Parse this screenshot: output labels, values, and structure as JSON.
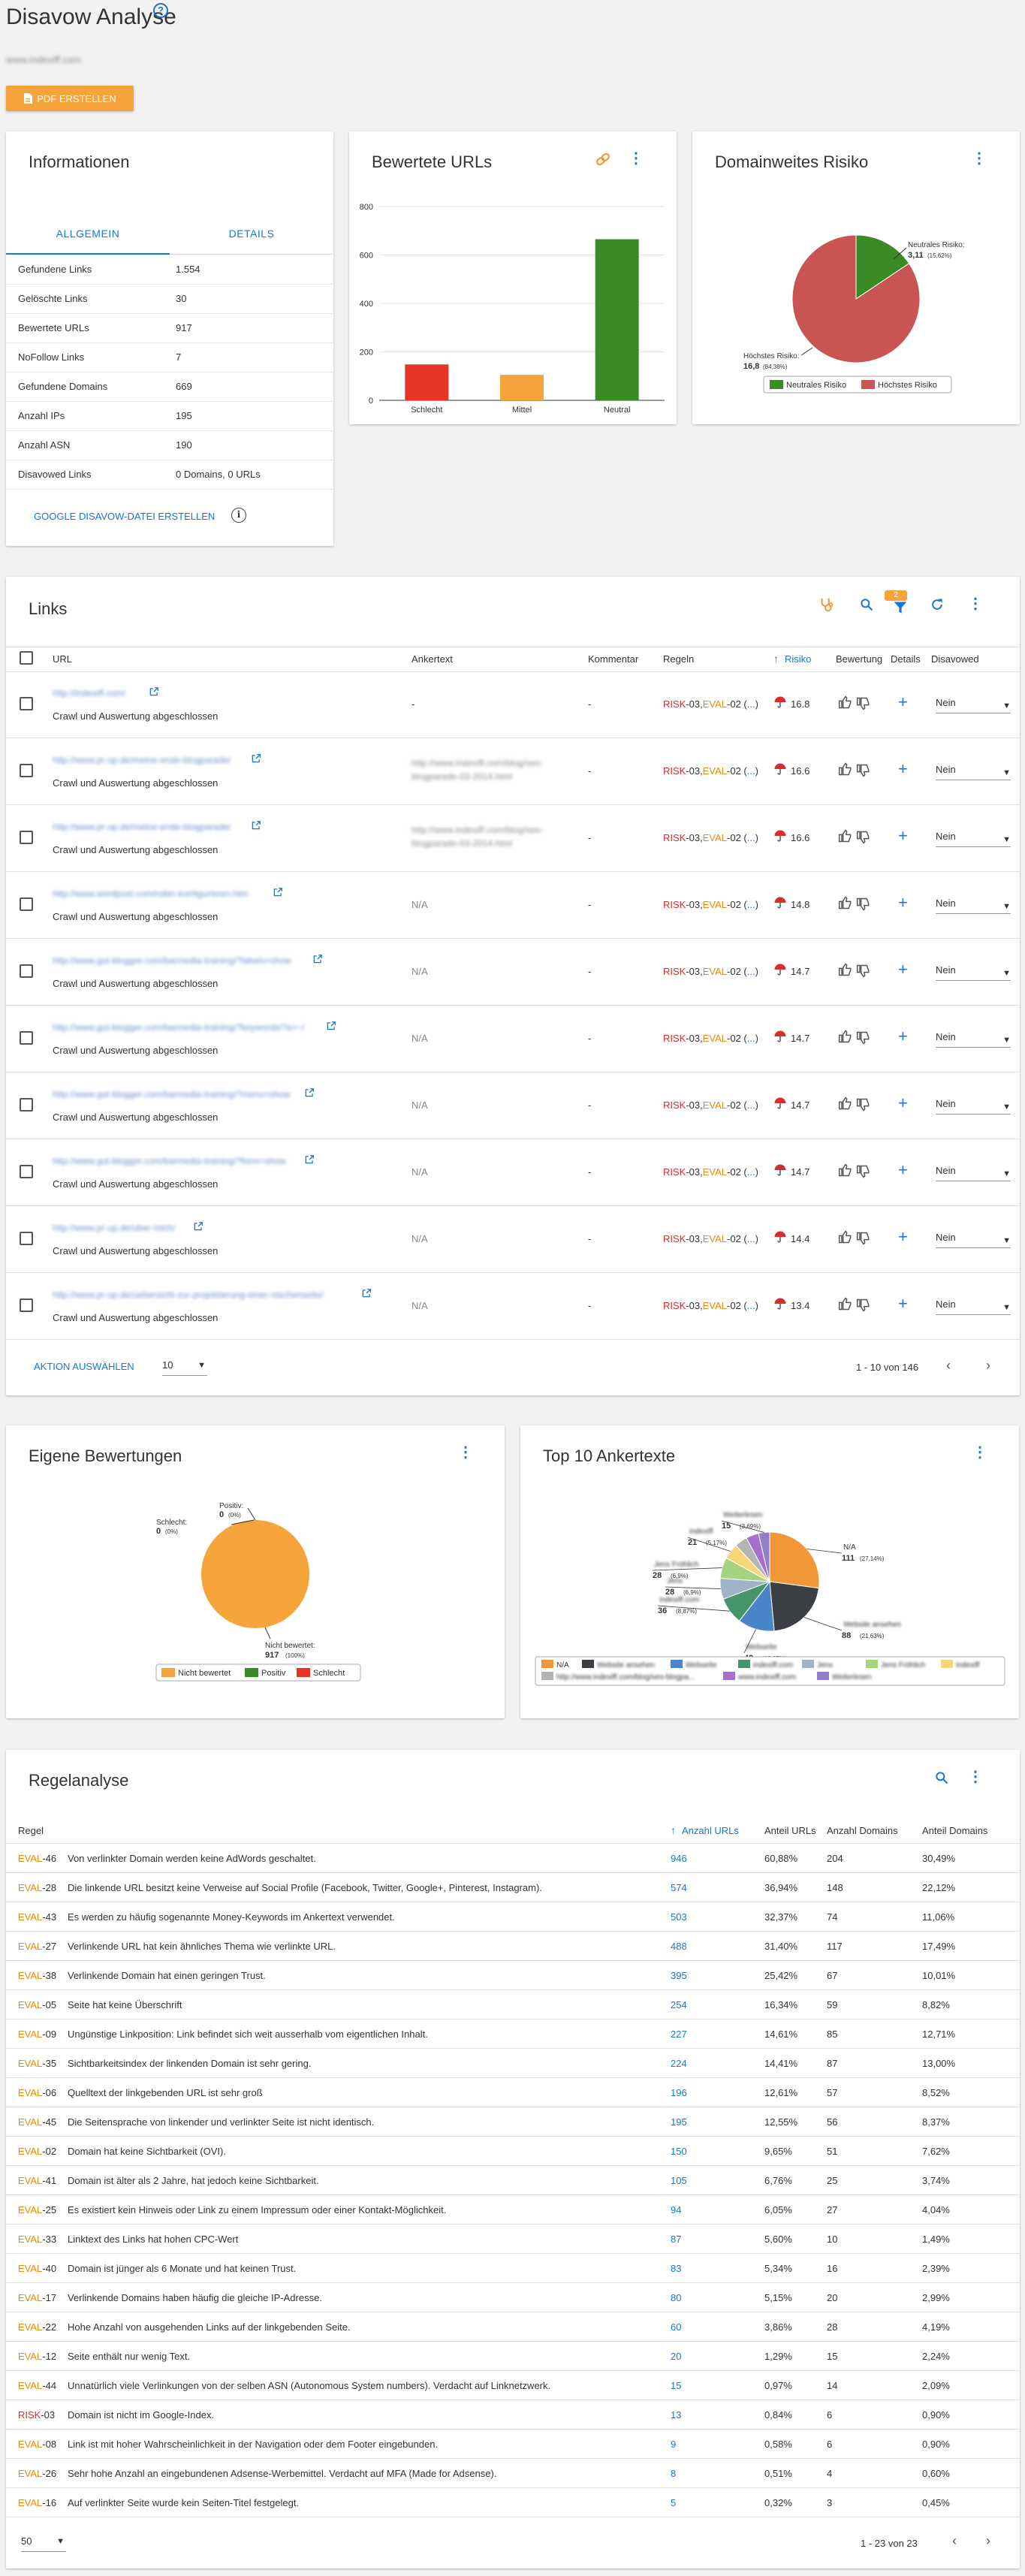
{
  "header": {
    "title": "Disavow Analyse",
    "domain": "www.indexiff.com",
    "pdf_button": "PDF ERSTELLEN"
  },
  "info": {
    "title": "Informationen",
    "tabs": [
      "ALLGEMEIN",
      "DETAILS"
    ],
    "rows": [
      {
        "label": "Gefundene Links",
        "value": "1.554"
      },
      {
        "label": "Gelöschte Links",
        "value": "30"
      },
      {
        "label": "Bewertete URLs",
        "value": "917"
      },
      {
        "label": "NoFollow Links",
        "value": "7"
      },
      {
        "label": "Gefundene Domains",
        "value": "669"
      },
      {
        "label": "Anzahl IPs",
        "value": "195"
      },
      {
        "label": "Anzahl ASN",
        "value": "190"
      },
      {
        "label": "Disavowed Links",
        "value": "0 Domains, 0 URLs"
      }
    ],
    "google_link": "GOOGLE DISAVOW-DATEI ERSTELLEN"
  },
  "bewertete": {
    "title": "Bewertete URLs",
    "chart_data": {
      "type": "bar",
      "categories": [
        "Schlecht",
        "Mittel",
        "Neutral"
      ],
      "values": [
        148,
        105,
        665
      ],
      "colors": [
        "#e53527",
        "#f4a43a",
        "#3a8a26"
      ],
      "ylim": [
        0,
        800
      ],
      "yticks": [
        "0",
        "200",
        "400",
        "600",
        "800"
      ]
    }
  },
  "domainrisk": {
    "title": "Domainweites Risiko",
    "chart_data": {
      "type": "pie",
      "slices": [
        {
          "name": "Neutrales Risiko",
          "value": 3.11,
          "pct": "(15,62%)",
          "color": "#3a8a26",
          "label": "Neutrales Risiko:",
          "display": "3,11"
        },
        {
          "name": "Höchstes Risiko",
          "value": 16.8,
          "pct": "(84,38%)",
          "color": "#c95553",
          "label": "Höchstes Risiko:",
          "display": "16,8"
        }
      ]
    },
    "legend": [
      "Neutrales Risiko",
      "Höchstes Risiko"
    ]
  },
  "links": {
    "title": "Links",
    "filter_badge": "2",
    "columns": {
      "url": "URL",
      "anchor": "Ankertext",
      "comment": "Kommentar",
      "rules": "Regeln",
      "risk": "Risiko",
      "rating": "Bewertung",
      "details": "Details",
      "disavowed": "Disavowed"
    },
    "rows": [
      {
        "url": "http://indexiff.com/",
        "status": "Crawl und Auswertung abgeschlossen",
        "anchor1": "-",
        "anchor2": "",
        "comment": "-",
        "risk": "16.8",
        "disavow": "Nein"
      },
      {
        "url": "http://www.pr-up.de/meine-erste-blogparade/",
        "status": "Crawl und Auswertung abgeschlossen",
        "anchor1": "http://www.indexiff.com/blog/seo-",
        "anchor2": "blogparade-03-2014.html",
        "comment": "-",
        "risk": "16.6",
        "disavow": "Nein"
      },
      {
        "url": "http://www.pr-up.de/meine-erste-blogparade/",
        "status": "Crawl und Auswertung abgeschlossen",
        "anchor1": "http://www.indexiff.com/blog/seo-",
        "anchor2": "blogparade-03-2014.html",
        "comment": "-",
        "risk": "16.6",
        "disavow": "Nein"
      },
      {
        "url": "http://www.wordpost.com/roller-konfigurieren.htm",
        "status": "Crawl und Auswertung abgeschlossen",
        "anchor1": "N/A",
        "anchor2": "",
        "comment": "-",
        "risk": "14.8",
        "disavow": "Nein"
      },
      {
        "url": "http://www.gut-blogger.com/barmedia-training/?labels=show",
        "status": "Crawl und Auswertung abgeschlossen",
        "anchor1": "N/A",
        "anchor2": "",
        "comment": "-",
        "risk": "14.7",
        "disavow": "Nein"
      },
      {
        "url": "http://www.gut-blogger.com/barmedia-training/?keywords/?s=~/",
        "status": "Crawl und Auswertung abgeschlossen",
        "anchor1": "N/A",
        "anchor2": "",
        "comment": "-",
        "risk": "14.7",
        "disavow": "Nein"
      },
      {
        "url": "http://www.gut-blogger.com/barmedia-training/?menu=show",
        "status": "Crawl und Auswertung abgeschlossen",
        "anchor1": "N/A",
        "anchor2": "",
        "comment": "-",
        "risk": "14.7",
        "disavow": "Nein"
      },
      {
        "url": "http://www.gut-blogger.com/barmedia-training/?form=show",
        "status": "Crawl und Auswertung abgeschlossen",
        "anchor1": "N/A",
        "anchor2": "",
        "comment": "-",
        "risk": "14.7",
        "disavow": "Nein"
      },
      {
        "url": "http://www.pr-up.de/uber-mich/",
        "status": "Crawl und Auswertung abgeschlossen",
        "anchor1": "N/A",
        "anchor2": "",
        "comment": "-",
        "risk": "14.4",
        "disavow": "Nein"
      },
      {
        "url": "http://www.pr-up.de/uebersicht-zur-projektierung-einer-nischenseite/",
        "status": "Crawl und Auswertung abgeschlossen",
        "anchor1": "N/A",
        "anchor2": "",
        "comment": "-",
        "risk": "13.4",
        "disavow": "Nein"
      }
    ],
    "rule_risk": "RISK",
    "rule_risk_num": "-03,",
    "rule_eval": "EVAL",
    "rule_eval_num": "-02 (",
    "rule_more": "...",
    "rule_close": ")",
    "action": "AKTION AUSWÄHLEN",
    "page_size": "10",
    "pagination": "1 - 10 von 146"
  },
  "eigene": {
    "title": "Eigene Bewertungen",
    "chart_data": {
      "type": "pie",
      "slices": [
        {
          "name": "Nicht bewertet",
          "value": 917,
          "pct": "(100%)",
          "color": "#f4a43a",
          "label": "Nicht bewertet:"
        },
        {
          "name": "Positiv",
          "value": 0,
          "pct": "(0%)",
          "color": "#3a8a26",
          "label": "Positiv:"
        },
        {
          "name": "Schlecht",
          "value": 0,
          "pct": "(0%)",
          "color": "#e53527",
          "label": "Schlecht:"
        }
      ]
    },
    "legend": [
      "Nicht bewertet",
      "Positiv",
      "Schlecht"
    ]
  },
  "top10": {
    "title": "Top 10 Ankertexte",
    "chart_data": {
      "type": "pie",
      "slices": [
        {
          "name": "N/A",
          "value": 111,
          "pct": "(27,14%)",
          "color": "#f29737"
        },
        {
          "name": "Website ansehen",
          "value": 88,
          "pct": "(21,63%)",
          "color": "#3b3e42"
        },
        {
          "name": "Webseite",
          "value": 49,
          "pct": "(12,07%)",
          "color": "#4a85c9"
        },
        {
          "name": "indexiff.com",
          "value": 36,
          "pct": "(8,87%)",
          "color": "#46956a"
        },
        {
          "name": "Jens",
          "value": 28,
          "pct": "(6,9%)",
          "color": "#9fb3c9"
        },
        {
          "name": "Jens Fröhlich",
          "value": 28,
          "pct": "(6,9%)",
          "color": "#a7d27f"
        },
        {
          "name": "indexiff",
          "value": 21,
          "pct": "(5,17%)",
          "color": "#f6d777"
        },
        {
          "name": "http://www.indexiff.com/blog/seo-blogpa...",
          "value": 17,
          "pct": "",
          "color": "#b4b4b4"
        },
        {
          "name": "www.indexiff.com",
          "value": 17,
          "pct": "",
          "color": "#a56fcb"
        },
        {
          "name": "Weiterlesen",
          "value": 15,
          "pct": "(3,69%)",
          "color": "#8f80c7"
        }
      ]
    }
  },
  "regel": {
    "title": "Regelanalyse",
    "columns": {
      "rule": "Regel",
      "count": "Anzahl URLs",
      "share": "Anteil URLs",
      "domains": "Anzahl Domains",
      "dshare": "Anteil Domains"
    },
    "rows": [
      {
        "p": "EVAL",
        "n": "-46",
        "t": "Von verlinkter Domain werden keine AdWords geschaltet.",
        "c": "946",
        "s": "60,88%",
        "d": "204",
        "ds": "30,49%"
      },
      {
        "p": "EVAL",
        "n": "-28",
        "t": "Die linkende URL besitzt keine Verweise auf Social Profile (Facebook, Twitter, Google+, Pinterest, Instagram).",
        "c": "574",
        "s": "36,94%",
        "d": "148",
        "ds": "22,12%"
      },
      {
        "p": "EVAL",
        "n": "-43",
        "t": "Es werden zu häufig sogenannte Money-Keywords im Ankertext verwendet.",
        "c": "503",
        "s": "32,37%",
        "d": "74",
        "ds": "11,06%"
      },
      {
        "p": "EVAL",
        "n": "-27",
        "t": "Verlinkende URL hat kein ähnliches Thema wie verlinkte URL.",
        "c": "488",
        "s": "31,40%",
        "d": "117",
        "ds": "17,49%"
      },
      {
        "p": "EVAL",
        "n": "-38",
        "t": "Verlinkende Domain hat einen geringen Trust.",
        "c": "395",
        "s": "25,42%",
        "d": "67",
        "ds": "10,01%"
      },
      {
        "p": "EVAL",
        "n": "-05",
        "t": "Seite hat keine Überschrift",
        "c": "254",
        "s": "16,34%",
        "d": "59",
        "ds": "8,82%"
      },
      {
        "p": "EVAL",
        "n": "-09",
        "t": "Ungünstige Linkposition: Link befindet sich weit ausserhalb vom eigentlichen Inhalt.",
        "c": "227",
        "s": "14,61%",
        "d": "85",
        "ds": "12,71%"
      },
      {
        "p": "EVAL",
        "n": "-35",
        "t": "Sichtbarkeitsindex der linkenden Domain ist sehr gering.",
        "c": "224",
        "s": "14,41%",
        "d": "87",
        "ds": "13,00%"
      },
      {
        "p": "EVAL",
        "n": "-06",
        "t": "Quelltext der linkgebenden URL ist sehr groß",
        "c": "196",
        "s": "12,61%",
        "d": "57",
        "ds": "8,52%"
      },
      {
        "p": "EVAL",
        "n": "-45",
        "t": "Die Seitensprache von linkender und verlinkter Seite ist nicht identisch.",
        "c": "195",
        "s": "12,55%",
        "d": "56",
        "ds": "8,37%"
      },
      {
        "p": "EVAL",
        "n": "-02",
        "t": "Domain hat keine Sichtbarkeit (OVI).",
        "c": "150",
        "s": "9,65%",
        "d": "51",
        "ds": "7,62%"
      },
      {
        "p": "EVAL",
        "n": "-41",
        "t": "Domain ist älter als 2 Jahre, hat jedoch keine Sichtbarkeit.",
        "c": "105",
        "s": "6,76%",
        "d": "25",
        "ds": "3,74%"
      },
      {
        "p": "EVAL",
        "n": "-25",
        "t": "Es existiert kein Hinweis oder Link zu einem Impressum oder einer Kontakt-Möglichkeit.",
        "c": "94",
        "s": "6,05%",
        "d": "27",
        "ds": "4,04%"
      },
      {
        "p": "EVAL",
        "n": "-33",
        "t": "Linktext des Links hat hohen CPC-Wert",
        "c": "87",
        "s": "5,60%",
        "d": "10",
        "ds": "1,49%"
      },
      {
        "p": "EVAL",
        "n": "-40",
        "t": "Domain ist jünger als 6 Monate und hat keinen Trust.",
        "c": "83",
        "s": "5,34%",
        "d": "16",
        "ds": "2,39%"
      },
      {
        "p": "EVAL",
        "n": "-17",
        "t": "Verlinkende Domains haben häufig die gleiche IP-Adresse.",
        "c": "80",
        "s": "5,15%",
        "d": "20",
        "ds": "2,99%"
      },
      {
        "p": "EVAL",
        "n": "-22",
        "t": "Hohe Anzahl von ausgehenden Links auf der linkgebenden Seite.",
        "c": "60",
        "s": "3,86%",
        "d": "28",
        "ds": "4,19%"
      },
      {
        "p": "EVAL",
        "n": "-12",
        "t": "Seite enthält nur wenig Text.",
        "c": "20",
        "s": "1,29%",
        "d": "15",
        "ds": "2,24%"
      },
      {
        "p": "EVAL",
        "n": "-44",
        "t": "Unnatürlich viele Verlinkungen von der selben ASN (Autonomous System numbers). Verdacht auf Linknetzwerk.",
        "c": "15",
        "s": "0,97%",
        "d": "14",
        "ds": "2,09%"
      },
      {
        "p": "RISK",
        "n": "-03",
        "t": "Domain ist nicht im Google-Index.",
        "c": "13",
        "s": "0,84%",
        "d": "6",
        "ds": "0,90%"
      },
      {
        "p": "EVAL",
        "n": "-08",
        "t": "Link ist mit hoher Wahrscheinlichkeit in der Navigation oder dem Footer eingebunden.",
        "c": "9",
        "s": "0,58%",
        "d": "6",
        "ds": "0,90%"
      },
      {
        "p": "EVAL",
        "n": "-26",
        "t": "Sehr hohe Anzahl an eingebundenen Adsense-Werbemittel. Verdacht auf MFA (Made for Adsense).",
        "c": "8",
        "s": "0,51%",
        "d": "4",
        "ds": "0,60%"
      },
      {
        "p": "EVAL",
        "n": "-16",
        "t": "Auf verlinkter Seite wurde kein Seiten-Titel festgelegt.",
        "c": "5",
        "s": "0,32%",
        "d": "3",
        "ds": "0,45%"
      }
    ],
    "page_size": "50",
    "pagination": "1 - 23 von 23"
  }
}
